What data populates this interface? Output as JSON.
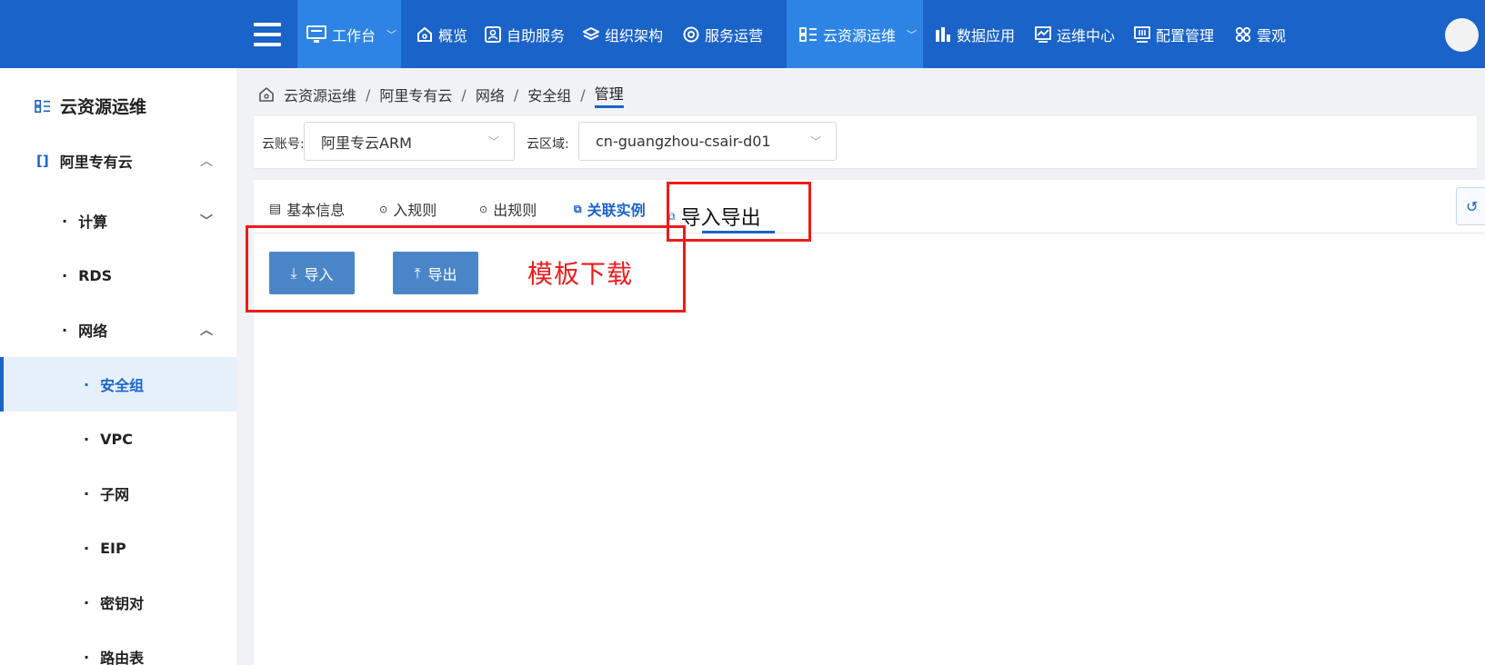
{
  "nav": {
    "items": [
      {
        "label": "工作台",
        "icon": "monitor-icon",
        "active": true,
        "dropdown": true
      },
      {
        "label": "概览",
        "icon": "home-icon"
      },
      {
        "label": "自助服务",
        "icon": "user-card-icon"
      },
      {
        "label": "组织架构",
        "icon": "layers-icon"
      },
      {
        "label": "服务运营",
        "icon": "cog-circle-icon"
      },
      {
        "label": "云资源运维",
        "icon": "org-icon",
        "active": true,
        "dropdown": true
      },
      {
        "label": "数据应用",
        "icon": "bar-chart-icon"
      },
      {
        "label": "运维中心",
        "icon": "line-chart-icon"
      },
      {
        "label": "配置管理",
        "icon": "config-icon"
      },
      {
        "label": "雲观",
        "icon": "clover-icon"
      }
    ]
  },
  "sidebar": {
    "title": "云资源运维",
    "group": "阿里专有云",
    "items": [
      {
        "label": "计算"
      },
      {
        "label": "RDS"
      },
      {
        "label": "网络"
      },
      {
        "label": "安全组",
        "active": true
      },
      {
        "label": "VPC"
      },
      {
        "label": "子网"
      },
      {
        "label": "EIP"
      },
      {
        "label": "密钥对"
      },
      {
        "label": "路由表"
      }
    ]
  },
  "breadcrumb": [
    "云资源运维",
    "阿里专有云",
    "网络",
    "安全组",
    "管理"
  ],
  "filters": {
    "account_label": "云账号:",
    "account_value": "阿里专云ARM",
    "region_label": "云区域:",
    "region_value": "cn-guangzhou-csair-d01"
  },
  "tabs": [
    {
      "label": "基本信息",
      "icon": "doc-icon"
    },
    {
      "label": "入规则",
      "icon": "rule-in-icon"
    },
    {
      "label": "出规则",
      "icon": "rule-out-icon"
    },
    {
      "label": "关联实例",
      "icon": "link-icon",
      "highlight": true
    },
    {
      "label": "导入导出",
      "icon": "copy-icon",
      "active": true
    }
  ],
  "actions": {
    "import_label": "导入",
    "export_label": "导出",
    "template_label": "模板下载"
  },
  "colors": {
    "topbar": "#1a63c8",
    "nav_active": "#2d84e4",
    "primary_button": "#4a86c7",
    "annotation": "#ee1b1b"
  }
}
